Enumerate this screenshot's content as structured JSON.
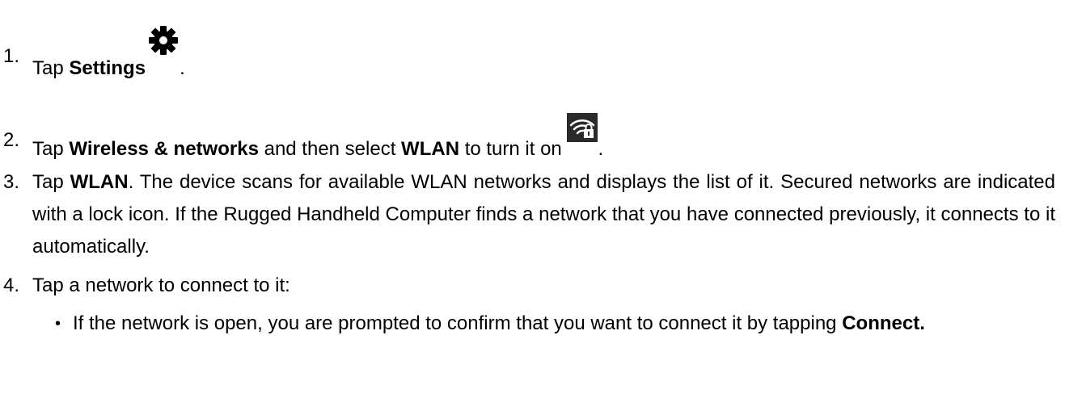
{
  "steps": [
    {
      "number": "1.",
      "prefix": "Tap ",
      "bold": "Settings",
      "icon": "gear-icon",
      "suffix": "."
    },
    {
      "number": "2.",
      "prefix": "Tap ",
      "bold1": "Wireless & networks",
      "mid": " and then select ",
      "bold2": "WLAN",
      "after": " to turn it on ",
      "icon": "wifi-lock-icon",
      "suffix": "."
    },
    {
      "number": "3.",
      "prefix": "Tap ",
      "bold": "WLAN",
      "rest": ". The device scans for available WLAN networks and displays the list of it. Secured networks are indicated with a lock icon. If the Rugged Handheld Computer finds a network that you have connected previously, it connects to it automatically."
    },
    {
      "number": "4.",
      "text": "Tap a network to connect to it:"
    }
  ],
  "bullets": [
    {
      "symbol": "•",
      "text": "If the network is open, you are prompted to confirm that you want to connect it by tapping ",
      "bold": "Connect."
    }
  ],
  "colors": {
    "text": "#000000",
    "icon_bg": "#2a2a2a",
    "icon_fg": "#ffffff"
  }
}
